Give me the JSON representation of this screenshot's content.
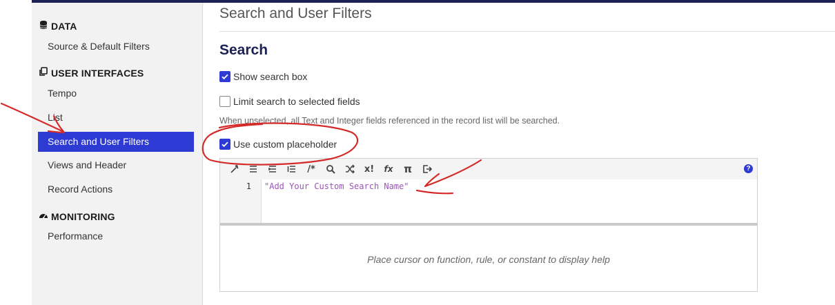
{
  "sidebar": {
    "sections": [
      {
        "title": "DATA",
        "icon": "database-icon",
        "items": [
          "Source & Default Filters"
        ]
      },
      {
        "title": "USER INTERFACES",
        "icon": "copy-icon",
        "items": [
          "Tempo",
          "List",
          "Search and User Filters",
          "Views and Header",
          "Record Actions"
        ]
      },
      {
        "title": "MONITORING",
        "icon": "speedometer-icon",
        "items": [
          "Performance"
        ]
      }
    ],
    "active_item": "Search and User Filters"
  },
  "main": {
    "page_title": "Search and User Filters",
    "section_title": "Search",
    "show_search_box": {
      "label": "Show search box",
      "checked": true
    },
    "limit_search": {
      "label": "Limit search to selected fields",
      "checked": false
    },
    "hint": "When unselected, all Text and Integer fields referenced in the record list will be searched.",
    "custom_placeholder": {
      "label": "Use custom placeholder",
      "checked": true
    }
  },
  "editor": {
    "toolbar_icons": [
      "format-icon",
      "list-icon",
      "list-indent-icon",
      "list-outdent-icon",
      "comment-icon",
      "search-icon",
      "shuffle-icon",
      "rule-icon",
      "function-icon",
      "pi-icon",
      "export-icon"
    ],
    "line_number": "1",
    "code": "\"Add Your Custom Search Name\"",
    "help_text": "Place cursor on function, rule, or constant to display help",
    "help_icon": "help-icon"
  },
  "colors": {
    "accent": "#2d3ad3",
    "navy": "#1b2255",
    "annotation": "#d42a2a"
  }
}
